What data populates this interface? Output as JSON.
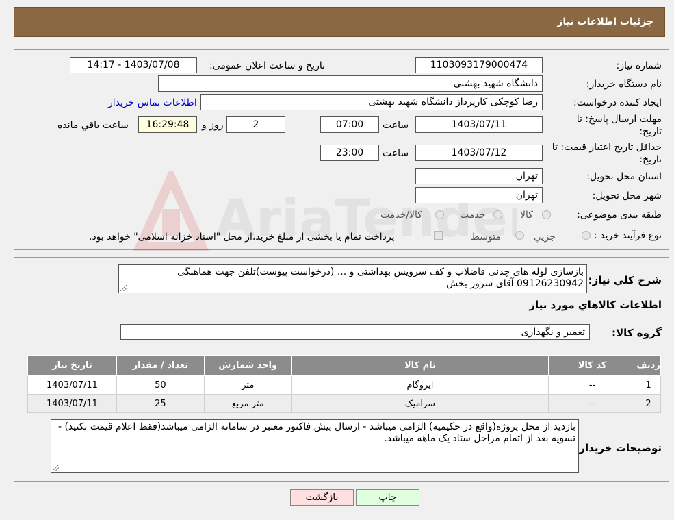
{
  "header": {
    "title": "جزئیات اطلاعات نیاز"
  },
  "form": {
    "need_number_label": "شماره نیاز:",
    "need_number": "1103093179000474",
    "announce_label": "تاریخ و ساعت اعلان عمومی:",
    "announce_value": "1403/07/08 - 14:17",
    "buyer_org_label": "نام دستگاه خریدار:",
    "buyer_org": "دانشگاه شهید بهشتی",
    "requester_label": "ایجاد کننده درخواست:",
    "requester": "رضا کوچکی کارپرداز دانشگاه شهید بهشتی",
    "contact_link": "اطلاعات تماس خریدار",
    "deadline_label_1": "مهلت ارسال پاسخ: تا",
    "deadline_label_2": "تاریخ:",
    "deadline_date": "1403/07/11",
    "hour_label": "ساعت",
    "deadline_time": "07:00",
    "days_value": "2",
    "days_label": "روز و",
    "remaining_time": "16:29:48",
    "remaining_label": "ساعت باقي مانده",
    "validity_label_1": "حداقل تاریخ اعتبار قیمت: تا",
    "validity_label_2": "تاریخ:",
    "validity_date": "1403/07/12",
    "validity_time": "23:00",
    "province_label": "استان محل تحویل:",
    "province": "تهران",
    "city_label": "شهر محل تحویل:",
    "city": "تهران",
    "category_label": "طبقه بندی موضوعی:",
    "category_options": [
      "کالا",
      "خدمت",
      "کالا/خدمت"
    ],
    "process_label": "نوع فرآیند خرید :",
    "process_options": [
      "جزیي",
      "متوسط"
    ],
    "process_note": "پرداخت تمام یا بخشی از مبلغ خرید،از محل \"اسناد خزانه اسلامی\" خواهد بود."
  },
  "details": {
    "description_label": "شرح کلي نياز:",
    "description": "بازسازی لوله های چدنی فاضلاب و کف سرویس بهداشتی و ... (درخواست پیوست)تلفن جهت هماهنگی 09126230942 آقای سرور بخش",
    "goods_info_title": "اطلاعات کالاهاي مورد نياز",
    "goods_group_label": "گروه کالا:",
    "goods_group": "تعمیر و نگهداری"
  },
  "table": {
    "headers": [
      "رديف",
      "کد کالا",
      "نام کالا",
      "واحد شمارش",
      "تعداد / مقدار",
      "تاریخ نیاز"
    ],
    "rows": [
      [
        "1",
        "--",
        "ایزوگام",
        "متر",
        "50",
        "1403/07/11"
      ],
      [
        "2",
        "--",
        "سرامیک",
        "متر مربع",
        "25",
        "1403/07/11"
      ]
    ]
  },
  "buyer_notes": {
    "label": "توضیحات خریدار:",
    "text": "بازدید از محل پروژه(واقع در حکیمیه) الزامی میباشد - ارسال پیش فاکتور معتبر در سامانه الزامی میباشد(فقط اعلام قیمت نکنید) - تسویه بعد از اتمام مراحل ستاد یک ماهه میباشد."
  },
  "buttons": {
    "print": "چاپ",
    "back": "بازگشت"
  },
  "watermark": {
    "text": "AriaTender.neT"
  },
  "colors": {
    "header_bg": "#8b6844",
    "table_header": "#8c8c8c",
    "back_button": "#ffe0e0",
    "print_button": "#e0ffe0"
  }
}
